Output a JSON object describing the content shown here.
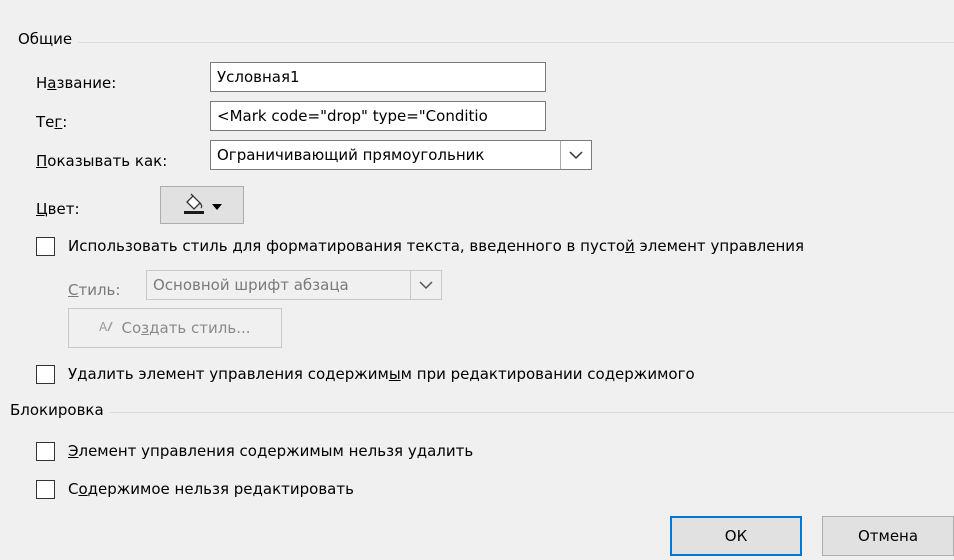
{
  "general": {
    "title": "Общие",
    "name_label_pre": "Н",
    "name_label_ul": "а",
    "name_label_post": "звание:",
    "name_value": "Условная1",
    "tag_label_pre": "Те",
    "tag_label_ul": "г",
    "tag_label_post": ":",
    "tag_value": "<Mark code=\"drop\" type=\"Conditio",
    "show_as_label_pre": "",
    "show_as_label_ul": "П",
    "show_as_label_post": "оказывать как:",
    "show_as_value": "Ограничивающий прямоугольник",
    "color_label_pre": "",
    "color_label_ul": "Ц",
    "color_label_post": "вет:",
    "use_style_checkbox_label_pre": "Использовать стиль для форматирования текста, введенного в пусто",
    "use_style_checkbox_label_ul": "й",
    "use_style_checkbox_label_post": " элемент управления",
    "use_style_checked": false,
    "style_label_pre": "",
    "style_label_ul": "С",
    "style_label_post": "тиль:",
    "style_value": "Основной шрифт абзаца",
    "create_style_pre": "Со",
    "create_style_ul": "з",
    "create_style_post": "дать стиль...",
    "remove_control_label_pre": "Удалить элемент управления содержим",
    "remove_control_label_ul": "ы",
    "remove_control_label_post": "м при редактировании содержимого",
    "remove_control_checked": false
  },
  "locking": {
    "title": "Блокировка",
    "cannot_delete_pre": "",
    "cannot_delete_ul": "Э",
    "cannot_delete_post": "лемент управления содержимым нельзя удалить",
    "cannot_delete_checked": false,
    "cannot_edit_pre": "С",
    "cannot_edit_ul": "о",
    "cannot_edit_post": "держимое нельзя редактировать",
    "cannot_edit_checked": false
  },
  "buttons": {
    "ok": "ОК",
    "cancel": "Отмена"
  },
  "icons": {
    "color": "paint-bucket-icon",
    "dropdown": "chevron-down-icon",
    "new_style": "new-style-icon"
  },
  "colors": {
    "accent": "#0078d7",
    "disabled_text": "#7a7a7a"
  }
}
